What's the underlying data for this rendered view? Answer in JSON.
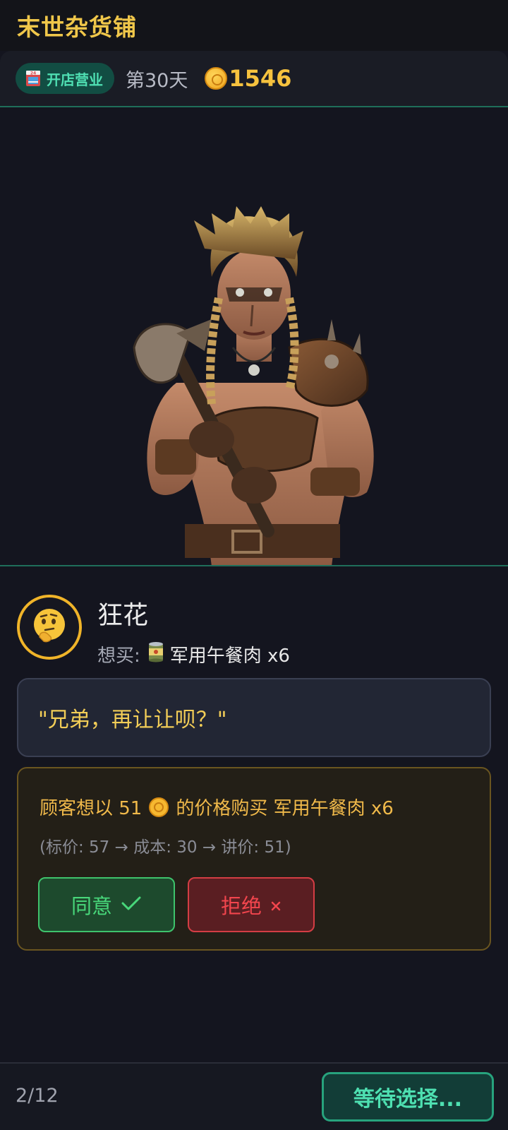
{
  "header": {
    "title": "末世杂货铺"
  },
  "status": {
    "open_badge": "开店营业",
    "day": "第30天",
    "coins": "1546"
  },
  "customer": {
    "name": "狂花",
    "avatar_icon": "thinking-face-icon",
    "want_label": "想买:",
    "want_item": "军用午餐肉 x6",
    "want_icon": "canned-food-icon"
  },
  "dialogue": {
    "text": "\"兄弟，再让让呗？\""
  },
  "offer": {
    "prefix": "顾客想以 51",
    "suffix": "的价格购买 军用午餐肉 x6",
    "price_detail": "(标价: 57 → 成本: 30 → 讲价: 51)",
    "agree_label": "同意",
    "refuse_label": "拒绝"
  },
  "footer": {
    "page": "2/12",
    "wait_label": "等待选择..."
  },
  "colors": {
    "accent_gold": "#f0c74a",
    "teal": "#4fe0b3",
    "agree_green": "#48d77a",
    "refuse_red": "#f2454d"
  }
}
